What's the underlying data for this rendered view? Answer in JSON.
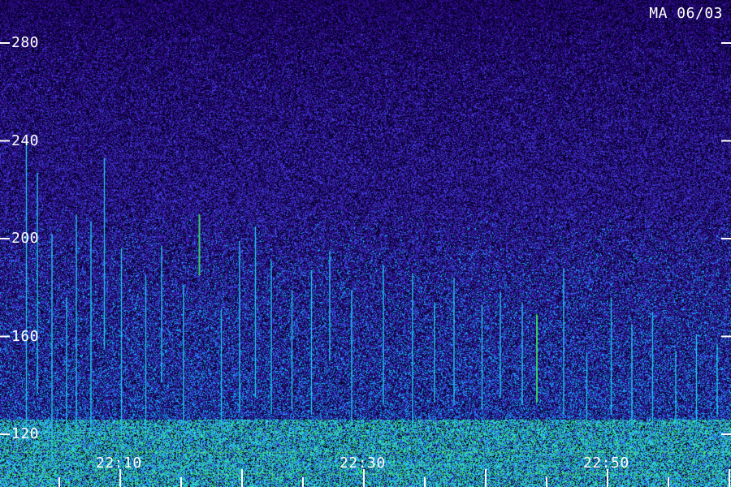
{
  "header": {
    "station_label": "MA 06/03"
  },
  "colors": {
    "background": "#2a0f5e",
    "noise_low": "#1a0a55",
    "noise_high": "#3030d0",
    "signal_cyan": "#20c8e8",
    "signal_green": "#40e060",
    "ticks": "#ffffff"
  },
  "chart_data": {
    "type": "heatmap",
    "title": "",
    "xlabel": "",
    "ylabel": "",
    "x_tick_labels": [
      "22:10",
      "22:30",
      "22:50"
    ],
    "x_ticks": [
      10,
      30,
      50
    ],
    "xlim": [
      0,
      60
    ],
    "y_tick_labels": [
      "280",
      "240",
      "200",
      "160",
      "120"
    ],
    "y_ticks": [
      280,
      240,
      200,
      160,
      120
    ],
    "ylim": [
      100,
      294
    ],
    "background_band": [
      100,
      126
    ],
    "colormap": [
      "#1a0a55",
      "#3030d0",
      "#20c8e8",
      "#40e060"
    ],
    "meteor_echoes": [
      {
        "t": 2.3,
        "f_top": 241,
        "f_bottom": 122,
        "color": "cyan"
      },
      {
        "t": 3.2,
        "f_top": 227,
        "f_bottom": 137,
        "color": "cyan"
      },
      {
        "t": 4.4,
        "f_top": 202,
        "f_bottom": 110,
        "color": "cyan"
      },
      {
        "t": 5.6,
        "f_top": 176,
        "f_bottom": 122,
        "color": "cyan"
      },
      {
        "t": 6.4,
        "f_top": 210,
        "f_bottom": 120,
        "color": "cyan"
      },
      {
        "t": 7.6,
        "f_top": 207,
        "f_bottom": 121,
        "color": "cyan"
      },
      {
        "t": 8.7,
        "f_top": 233,
        "f_bottom": 155,
        "color": "cyan"
      },
      {
        "t": 10.1,
        "f_top": 196,
        "f_bottom": 120,
        "color": "cyan"
      },
      {
        "t": 12.1,
        "f_top": 185,
        "f_bottom": 118,
        "color": "cyan"
      },
      {
        "t": 13.4,
        "f_top": 197,
        "f_bottom": 141,
        "color": "cyan"
      },
      {
        "t": 15.2,
        "f_top": 181,
        "f_bottom": 125,
        "color": "cyan"
      },
      {
        "t": 16.5,
        "f_top": 210,
        "f_bottom": 185,
        "color": "green"
      },
      {
        "t": 18.3,
        "f_top": 171,
        "f_bottom": 122,
        "color": "cyan"
      },
      {
        "t": 19.8,
        "f_top": 199,
        "f_bottom": 129,
        "color": "cyan"
      },
      {
        "t": 21.1,
        "f_top": 205,
        "f_bottom": 135,
        "color": "cyan"
      },
      {
        "t": 22.4,
        "f_top": 191,
        "f_bottom": 129,
        "color": "cyan"
      },
      {
        "t": 24.1,
        "f_top": 179,
        "f_bottom": 130,
        "color": "cyan"
      },
      {
        "t": 25.7,
        "f_top": 187,
        "f_bottom": 128,
        "color": "cyan"
      },
      {
        "t": 27.2,
        "f_top": 195,
        "f_bottom": 150,
        "color": "cyan"
      },
      {
        "t": 29.0,
        "f_top": 179,
        "f_bottom": 124,
        "color": "cyan"
      },
      {
        "t": 31.6,
        "f_top": 189,
        "f_bottom": 132,
        "color": "cyan"
      },
      {
        "t": 34.0,
        "f_top": 186,
        "f_bottom": 122,
        "color": "cyan"
      },
      {
        "t": 35.8,
        "f_top": 174,
        "f_bottom": 133,
        "color": "cyan"
      },
      {
        "t": 37.4,
        "f_top": 184,
        "f_bottom": 132,
        "color": "cyan"
      },
      {
        "t": 39.7,
        "f_top": 173,
        "f_bottom": 130,
        "color": "cyan"
      },
      {
        "t": 41.2,
        "f_top": 178,
        "f_bottom": 135,
        "color": "cyan"
      },
      {
        "t": 43.0,
        "f_top": 174,
        "f_bottom": 132,
        "color": "cyan"
      },
      {
        "t": 44.2,
        "f_top": 169,
        "f_bottom": 133,
        "color": "green"
      },
      {
        "t": 46.4,
        "f_top": 188,
        "f_bottom": 128,
        "color": "cyan"
      },
      {
        "t": 48.3,
        "f_top": 153,
        "f_bottom": 125,
        "color": "cyan"
      },
      {
        "t": 50.3,
        "f_top": 176,
        "f_bottom": 128,
        "color": "cyan"
      },
      {
        "t": 52.0,
        "f_top": 165,
        "f_bottom": 124,
        "color": "cyan"
      },
      {
        "t": 53.7,
        "f_top": 170,
        "f_bottom": 126,
        "color": "cyan"
      },
      {
        "t": 55.6,
        "f_top": 154,
        "f_bottom": 125,
        "color": "cyan"
      },
      {
        "t": 57.3,
        "f_top": 161,
        "f_bottom": 124,
        "color": "cyan"
      },
      {
        "t": 59.0,
        "f_top": 157,
        "f_bottom": 127,
        "color": "cyan"
      }
    ]
  }
}
